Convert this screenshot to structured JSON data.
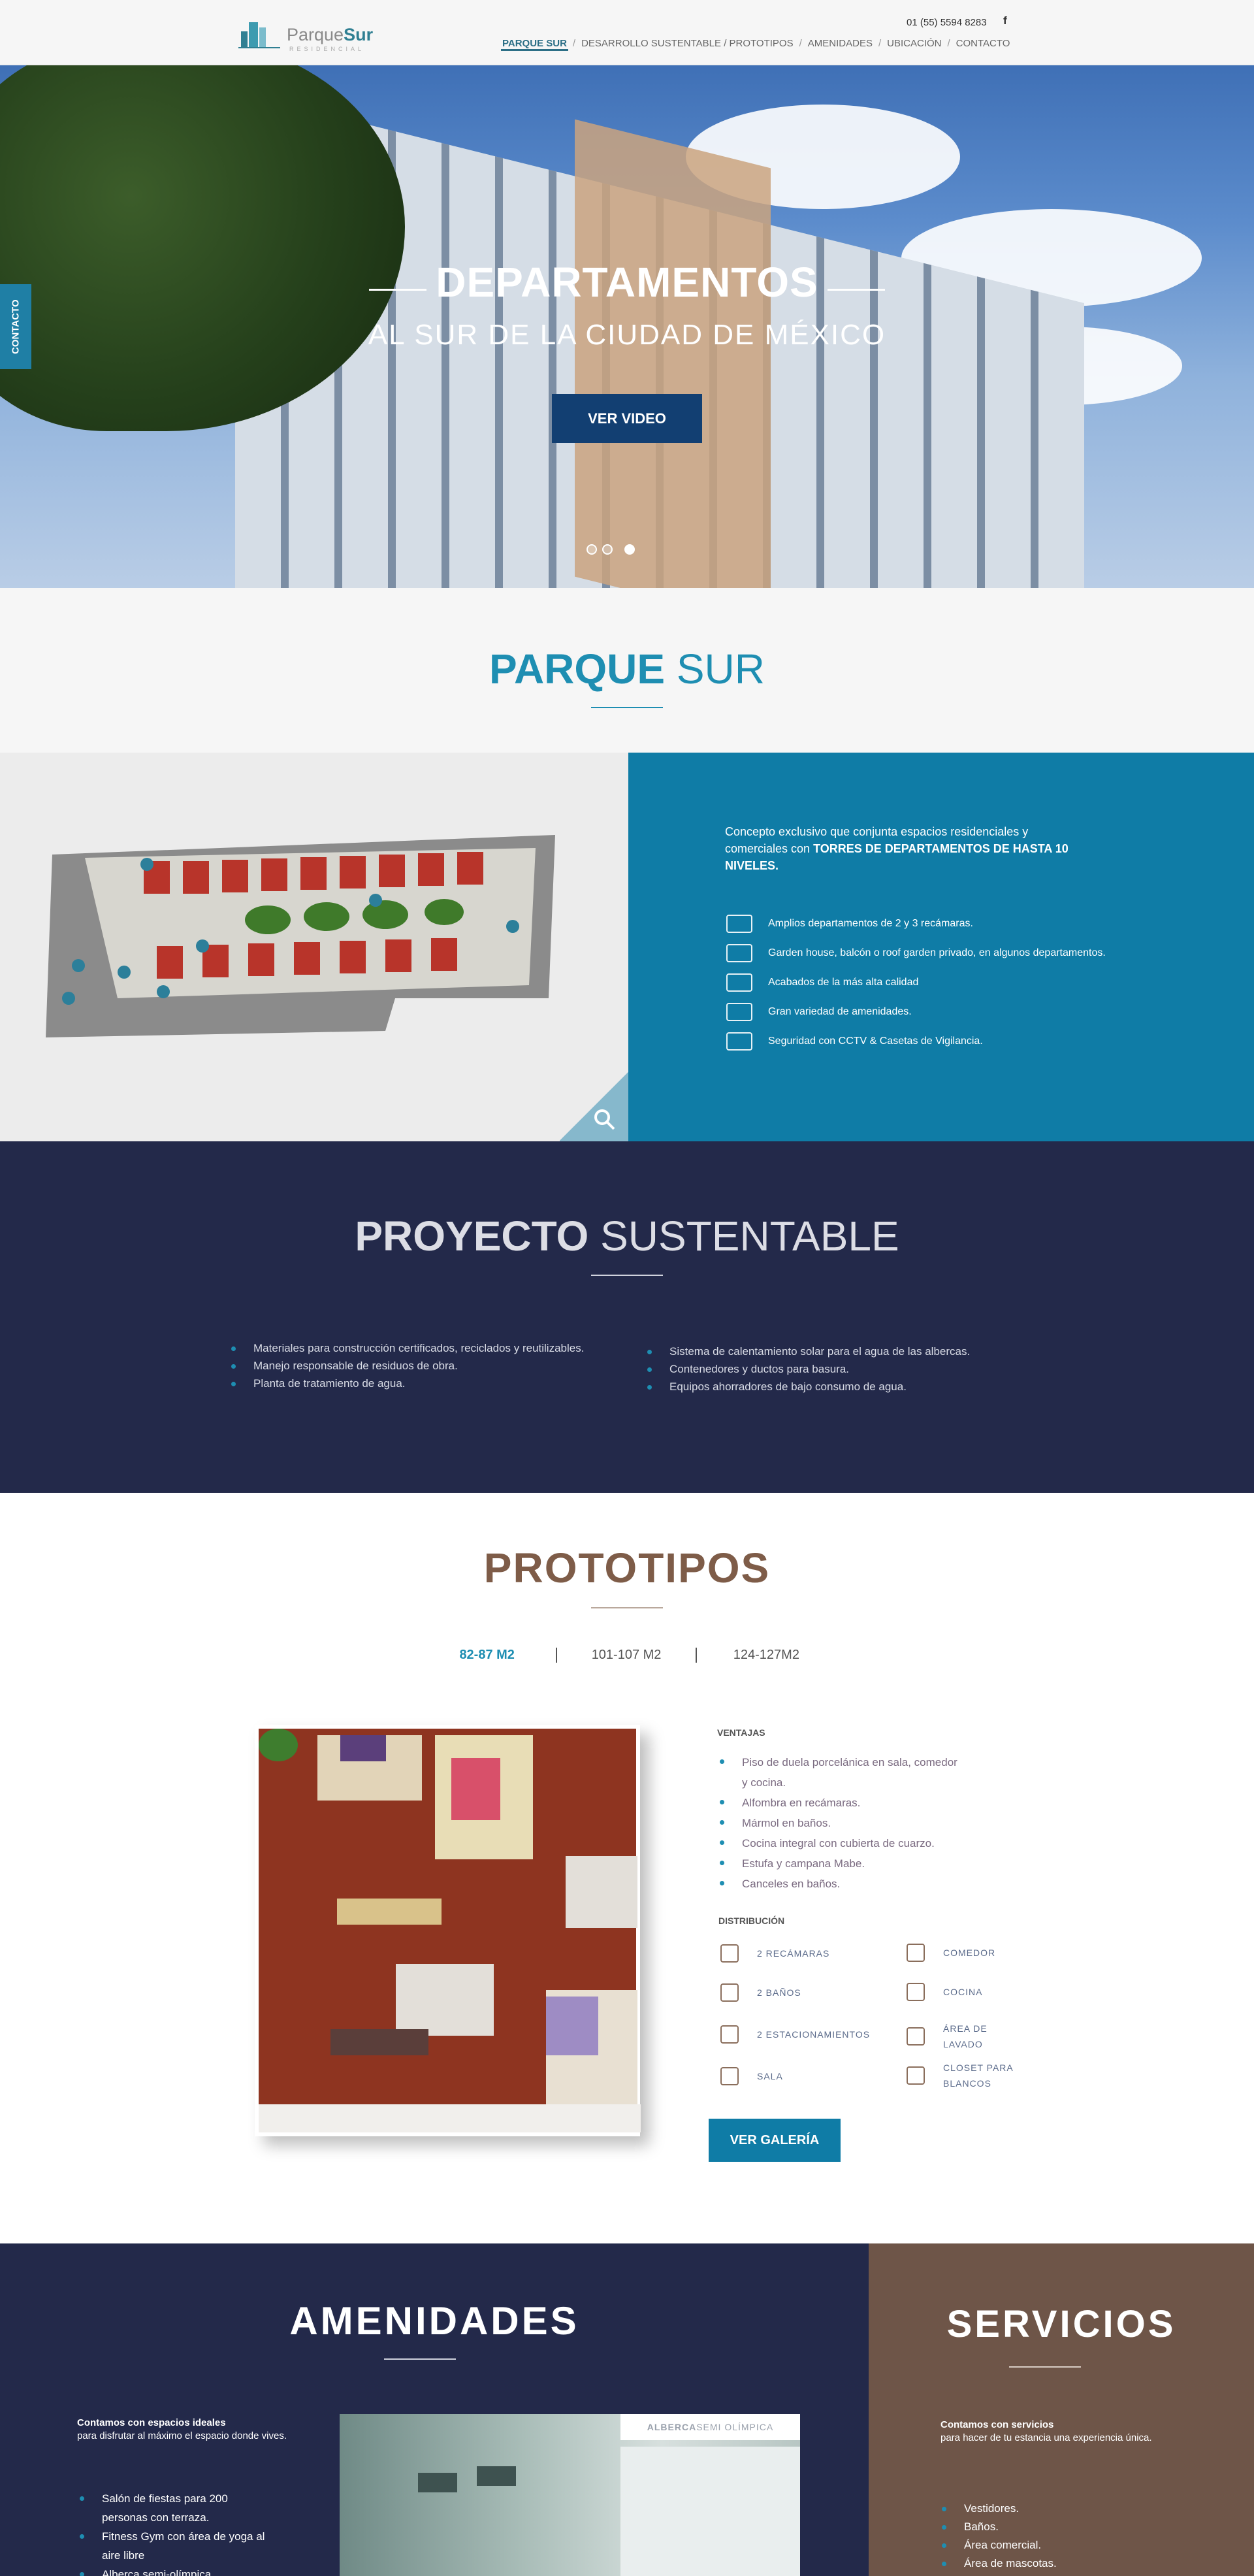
{
  "header": {
    "logo_text_a": "Parque",
    "logo_text_b": "Sur",
    "logo_sub": "RESIDENCIAL",
    "phone": "01 (55) 5594 8283",
    "social": "f",
    "nav": [
      "PARQUE SUR",
      "DESARROLLO SUSTENTABLE / PROTOTIPOS",
      "AMENIDADES",
      "UBICACIÓN",
      "CONTACTO"
    ]
  },
  "hero": {
    "title": "DEPARTAMENTOS",
    "subtitle": "AL SUR DE LA CIUDAD DE MÉXICO",
    "button": "VER VIDEO",
    "side_tab": "CONTACTO",
    "slides": 3,
    "active_slide": 3
  },
  "parque_sur": {
    "title_bold": "PARQUE",
    "title_light": " SUR",
    "intro_a": "Concepto exclusivo que conjunta espacios residenciales y comerciales con ",
    "intro_b": "TORRES DE DEPARTAMENTOS DE HASTA 10 NIVELES.",
    "features": [
      {
        "icon": "bed-icon",
        "text": "Amplios departamentos de 2 y 3 recámaras."
      },
      {
        "icon": "garden-icon",
        "text": "Garden house, balcón o roof garden privado, en algunos departamentos."
      },
      {
        "icon": "column-icon",
        "text": "Acabados de la más alta calidad"
      },
      {
        "icon": "pool-icon",
        "text": "Gran variedad de amenidades."
      },
      {
        "icon": "cctv-icon",
        "text": "Seguridad con CCTV & Casetas de Vigilancia."
      }
    ]
  },
  "sustentable": {
    "title_bold": "PROYECTO",
    "title_light": " SUSTENTABLE",
    "left": [
      "Materiales para construcción certificados, reciclados y reutilizables.",
      "Manejo responsable de residuos de obra.",
      "Planta de tratamiento de agua."
    ],
    "right": [
      "Sistema de calentamiento solar para el agua de las albercas.",
      "Contenedores y ductos para basura.",
      "Equipos ahorradores de  bajo consumo de agua."
    ]
  },
  "prototipos": {
    "title": "PROTOTIPOS",
    "tabs": [
      "82-87 M2",
      "101-107 M2",
      "124-127M2"
    ],
    "active_tab": 0,
    "ventajas_title": "VENTAJAS",
    "ventajas": [
      "Piso de duela porcelánica en sala, comedor y cocina.",
      "Alfombra en recámaras.",
      "Mármol en baños.",
      "Cocina integral con cubierta de cuarzo.",
      "Estufa y campana Mabe.",
      "Canceles en baños."
    ],
    "distribucion_title": "DISTRIBUCIÓN",
    "distribucion_left": [
      "2 RECÁMARAS",
      "2 BAÑOS",
      "2 ESTACIONAMIENTOS",
      "SALA"
    ],
    "distribucion_right": [
      "COMEDOR",
      "COCINA",
      "ÁREA DE LAVADO",
      "CLOSET PARA BLANCOS"
    ],
    "button": "VER GALERÍA"
  },
  "amenidades": {
    "title": "AMENIDADES",
    "intro_bold": "Contamos con espacios ideales",
    "intro": "para disfrutar al máximo el espacio donde vives.",
    "items": [
      "Salón de fiestas para 200 personas con terraza.",
      "Fitness Gym con área de yoga al aire libre",
      "Alberca semi-olímpica"
    ],
    "photo_label_bold": "ALBERCA",
    "photo_label": " SEMI OLÍMPICA"
  },
  "servicios": {
    "title": "SERVICIOS",
    "intro_bold": "Contamos con servicios",
    "intro": "para hacer de tu estancia una experiencia única.",
    "items": [
      "Vestidores.",
      "Baños.",
      "Área comercial.",
      "Área de mascotas."
    ]
  },
  "colors": {
    "primary": "#0f7ca6",
    "navy": "#23294a",
    "brown": "#7e5c48"
  }
}
